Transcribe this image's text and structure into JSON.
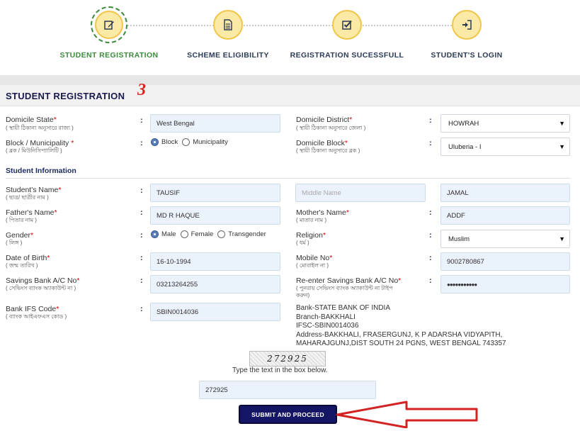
{
  "stepper": {
    "steps": [
      {
        "label": "STUDENT REGISTRATION",
        "icon": "edit-icon",
        "active": true
      },
      {
        "label": "SCHEME ELIGIBILITY",
        "icon": "document-icon",
        "active": false
      },
      {
        "label": "REGISTRATION SUCESSFULL",
        "icon": "checkbox-icon",
        "active": false
      },
      {
        "label": "STUDENT'S LOGIN",
        "icon": "login-icon",
        "active": false
      }
    ]
  },
  "form": {
    "title": "STUDENT REGISTRATION",
    "annotation_number": "3",
    "domicile_state": {
      "label": "Domicile State",
      "sub": "( স্থায়ী ঠিকানা অনুসারে রাজ্য )",
      "value": "West Bengal"
    },
    "domicile_district": {
      "label": "Domicile District",
      "sub": "( স্থায়ী ঠিকানা অনুসারে জেলা )",
      "value": "HOWRAH"
    },
    "block_municipality": {
      "label": "Block / Municipality",
      "sub": "( ব্লক / মিউনিসিপ্যালিটি )",
      "options": [
        "Block",
        "Municipality"
      ],
      "selected": "Block"
    },
    "domicile_block": {
      "label": "Domicile Block",
      "sub": "( স্থায়ী ঠিকানা অনুসারে ব্লক )",
      "value": "Uluberia - I"
    },
    "section_student_info": "Student Information",
    "student_name": {
      "label": "Student's Name",
      "sub": "( ছাত্র/ ছাত্রীর নাম )",
      "first": "TAUSIF",
      "middle_placeholder": "Middle Name",
      "last": "JAMAL"
    },
    "father_name": {
      "label": "Father's Name",
      "sub": "( পিতার নাম )",
      "value": "MD R HAQUE"
    },
    "mother_name": {
      "label": "Mother's Name",
      "sub": "( মাতার নাম )",
      "value": "ADDF"
    },
    "gender": {
      "label": "Gender",
      "sub": "( লিঙ্গ )",
      "options": [
        "Male",
        "Female",
        "Transgender"
      ],
      "selected": "Male"
    },
    "religion": {
      "label": "Religion",
      "sub": "( ধর্ম )",
      "value": "Muslim"
    },
    "dob": {
      "label": "Date of Birth",
      "sub": "( জন্ম তারিখ )",
      "value": "16-10-1994"
    },
    "mobile": {
      "label": "Mobile No",
      "sub": "( মোবাইল না )",
      "value": "9002780867"
    },
    "savings_ac": {
      "label": "Savings Bank A/C No",
      "sub": "( সেভিংস ব্যাংক অ্যাকাউন্ট না )",
      "value": "03213264255"
    },
    "reenter_savings_ac": {
      "label": "Re-enter Savings Bank A/C No",
      "sub_line1": "( পুনরায় সেভিংস ব্যাংক অ্যাকাউন্ট না টাইপ",
      "sub_line2": "করুন)",
      "value": "●●●●●●●●●●●"
    },
    "ifsc": {
      "label": "Bank IFS Code",
      "sub": "( ব্যাংক আইএফএস কোড )",
      "value": "SBIN0014036"
    },
    "bank_info": [
      "Bank-STATE BANK OF INDIA",
      "Branch-BAKKHALI",
      "IFSC-SBIN0014036",
      "Address-BAKKHALI, FRASERGUNJ, K P ADARSHA VIDYAPITH,",
      "MAHARAJGUNJ,DIST SOUTH 24 PGNS, WEST BENGAL 743357"
    ],
    "captcha_image_text": "272925",
    "captcha_hint": "Type the text in the box below.",
    "captcha_value": "272925",
    "submit_label": "SUBMIT AND PROCEED",
    "required_mark": "*",
    "colon": ":"
  },
  "colors": {
    "accent_green": "#3c8a3c",
    "step_yellow": "#fbe9a6",
    "navy": "#151566",
    "annotation_red": "#d22222"
  }
}
